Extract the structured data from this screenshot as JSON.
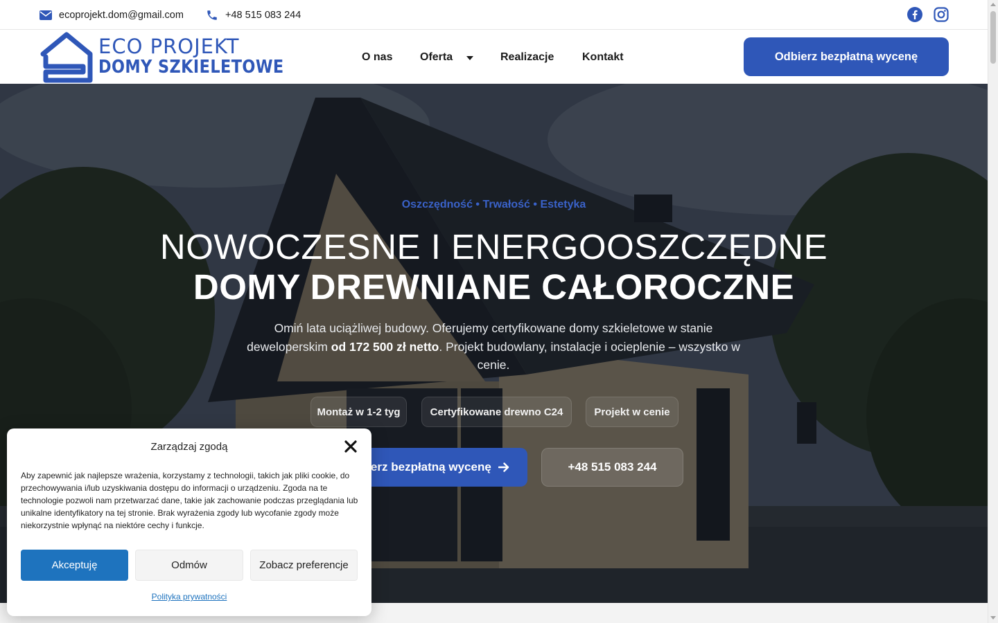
{
  "topbar": {
    "email": "ecoprojekt.dom@gmail.com",
    "phone": "+48 515 083 244"
  },
  "header": {
    "logo_line1": "ECO PROJEKT",
    "logo_line2": "DOMY SZKIELETOWE",
    "nav": {
      "about": "O nas",
      "offer": "Oferta",
      "projects": "Realizacje",
      "contact": "Kontakt"
    },
    "cta": "Odbierz bezpłatną wycenę"
  },
  "hero": {
    "tagline": "Oszczędność • Trwałość • Estetyka",
    "title_line1": "NOWOCZESNE I ENERGOOSZCZĘDNE",
    "title_line2": "DOMY DREWNIANE CAŁOROCZNE",
    "lead_part1": "Omiń lata uciążliwej budowy. Oferujemy certyfikowane domy szkieletowe w stanie deweloperskim ",
    "lead_bold": "od 172 500 zł netto",
    "lead_part2": ". Projekt budowlany, instalacje i ocieplenie – wszystko w cenie.",
    "pills": [
      "Montaż w 1-2 tyg",
      "Certyfikowane drewno C24",
      "Projekt w cenie"
    ],
    "cta": "Odbierz bezpłatną wycenę",
    "phone_button": "+48 515 083 244"
  },
  "cookie": {
    "title": "Zarządzaj zgodą",
    "text": "Aby zapewnić jak najlepsze wrażenia, korzystamy z technologii, takich jak pliki cookie, do przechowywania i/lub uzyskiwania dostępu do informacji o urządzeniu. Zgoda na te technologie pozwoli nam przetwarzać dane, takie jak zachowanie podczas przeglądania lub unikalne identyfikatory na tej stronie. Brak wyrażenia zgody lub wycofanie zgody może niekorzystnie wpłynąć na niektóre cechy i funkcje.",
    "accept": "Akceptuję",
    "deny": "Odmów",
    "preferences": "Zobacz preferencje",
    "privacy_link": "Polityka prywatności"
  },
  "colors": {
    "brand_blue": "#2f57b8",
    "tagline_blue": "#3a62c9",
    "cookie_accept": "#1e73be"
  },
  "icons": [
    "envelope-icon",
    "phone-icon",
    "facebook-icon",
    "instagram-icon",
    "caret-down-icon",
    "arrow-right-icon",
    "close-icon",
    "house-logo-icon"
  ]
}
